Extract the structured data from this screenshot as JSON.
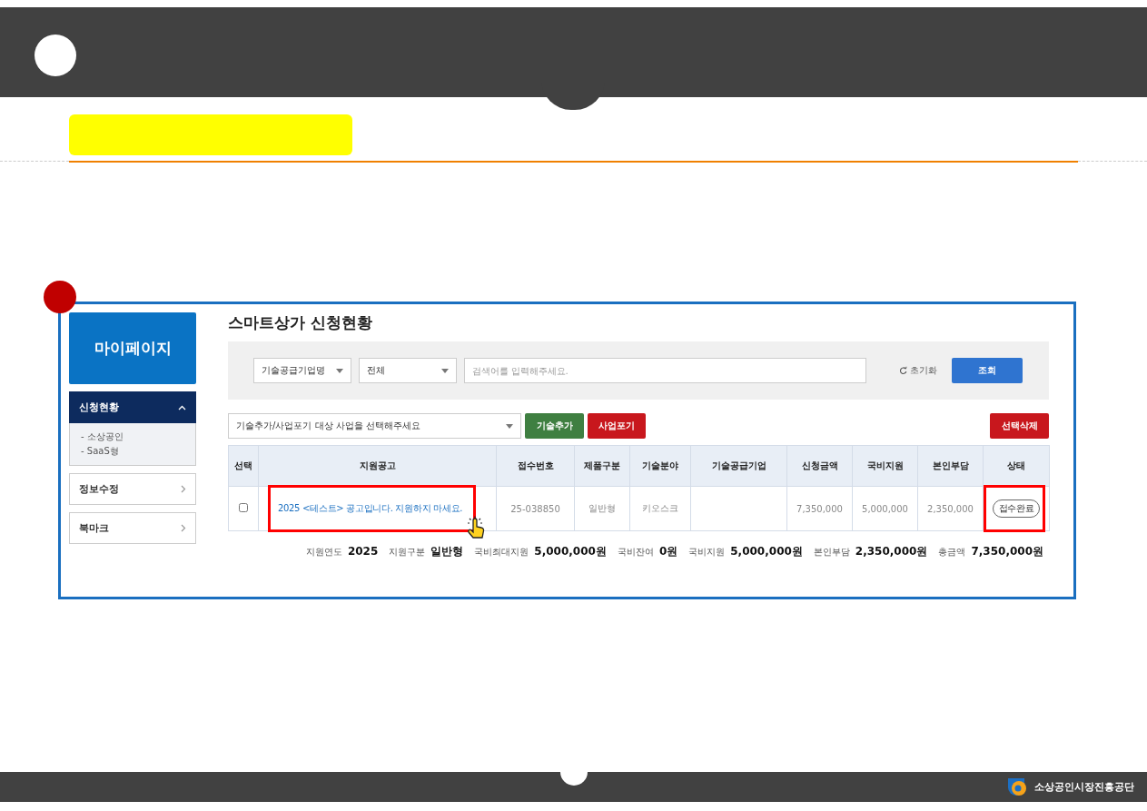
{
  "sidebar": {
    "title": "마이페이지",
    "menu": [
      {
        "label": "신청현황",
        "expanded": true,
        "children": [
          {
            "label": "- 소상공인"
          },
          {
            "label": "- SaaS형"
          }
        ]
      },
      {
        "label": "정보수정",
        "expanded": false
      },
      {
        "label": "북마크",
        "expanded": false
      }
    ]
  },
  "page_title": "스마트상가 신청현황",
  "search": {
    "selects": [
      "기술공급기업명",
      "전체"
    ],
    "placeholder": "검색어를 입력해주세요.",
    "reset": "초기화",
    "submit": "조회"
  },
  "actions": {
    "select": "기술추가/사업포기 대상 사업을 선택해주세요",
    "buttons": [
      {
        "label": "기술추가",
        "color": "#3f7f41"
      },
      {
        "label": "사업포기",
        "color": "#c8171d"
      }
    ],
    "delete": {
      "label": "선택삭제",
      "color": "#c8171d"
    }
  },
  "table": {
    "columns": [
      "선택",
      "지원공고",
      "접수번호",
      "제품구분",
      "기술분야",
      "기술공급기업",
      "신청금액",
      "국비지원",
      "본인부담",
      "상태"
    ],
    "rows": [
      {
        "cells": [
          {
            "kind": "checkbox",
            "checked": false
          },
          {
            "kind": "link",
            "text": "2025 <테스트> 공고입니다. 지원하지 마세요.",
            "highlighted": true
          },
          {
            "kind": "text",
            "text": "25-038850"
          },
          {
            "kind": "text",
            "text": "일반형"
          },
          {
            "kind": "text",
            "text": "키오스크"
          },
          {
            "kind": "text"
          },
          {
            "kind": "text",
            "text": "7,350,000"
          },
          {
            "kind": "text",
            "text": "5,000,000"
          },
          {
            "kind": "text",
            "text": "2,350,000"
          },
          {
            "kind": "badge",
            "text": "접수완료",
            "highlighted": true
          }
        ]
      }
    ]
  },
  "summary": [
    {
      "label": "지원연도",
      "value": "2025"
    },
    {
      "label": "지원구분",
      "value": "일반형"
    },
    {
      "label": "국비최대지원",
      "value": "5,000,000원"
    },
    {
      "label": "국비잔여",
      "value": "0원"
    },
    {
      "label": "국비지원",
      "value": "5,000,000원"
    },
    {
      "label": "본인부담",
      "value": "2,350,000원"
    },
    {
      "label": "총금액",
      "value": "7,350,000원"
    }
  ],
  "footer": {
    "organization": "소상공인시장진흥공단"
  }
}
